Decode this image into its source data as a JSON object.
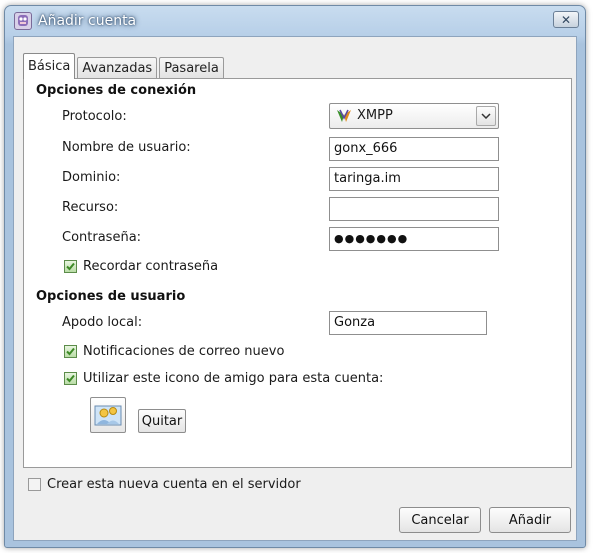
{
  "window": {
    "title": "Añadir cuenta",
    "close_glyph": "✕"
  },
  "tabs": [
    {
      "label": "Básica",
      "active": true
    },
    {
      "label": "Avanzadas",
      "active": false
    },
    {
      "label": "Pasarela",
      "active": false
    }
  ],
  "connection": {
    "section_title": "Opciones de conexión",
    "protocol_label": "Protocolo:",
    "protocol_value": "XMPP",
    "protocol_icon": "xmpp-icon",
    "username_label": "Nombre de usuario:",
    "username_value": "gonx_666",
    "domain_label": "Dominio:",
    "domain_value": "taringa.im",
    "resource_label": "Recurso:",
    "resource_value": "",
    "password_label": "Contraseña:",
    "password_value": "●●●●●●●",
    "remember_label": "Recordar contraseña",
    "remember_checked": true
  },
  "user_options": {
    "section_title": "Opciones de usuario",
    "alias_label": "Apodo local:",
    "alias_value": "Gonza",
    "mail_notify_label": "Notificaciones de correo nuevo",
    "mail_notify_checked": true,
    "buddy_icon_label": "Utilizar este icono de amigo para esta cuenta:",
    "buddy_icon_checked": true,
    "remove_label": "Quitar"
  },
  "create_on_server": {
    "label": "Crear esta nueva cuenta en el servidor",
    "checked": false
  },
  "buttons": {
    "cancel": "Cancelar",
    "add": "Añadir"
  },
  "colors": {
    "check_green": "#3d8a26",
    "title_text": "#ffffff",
    "frame_blue": "#a9c3de"
  }
}
